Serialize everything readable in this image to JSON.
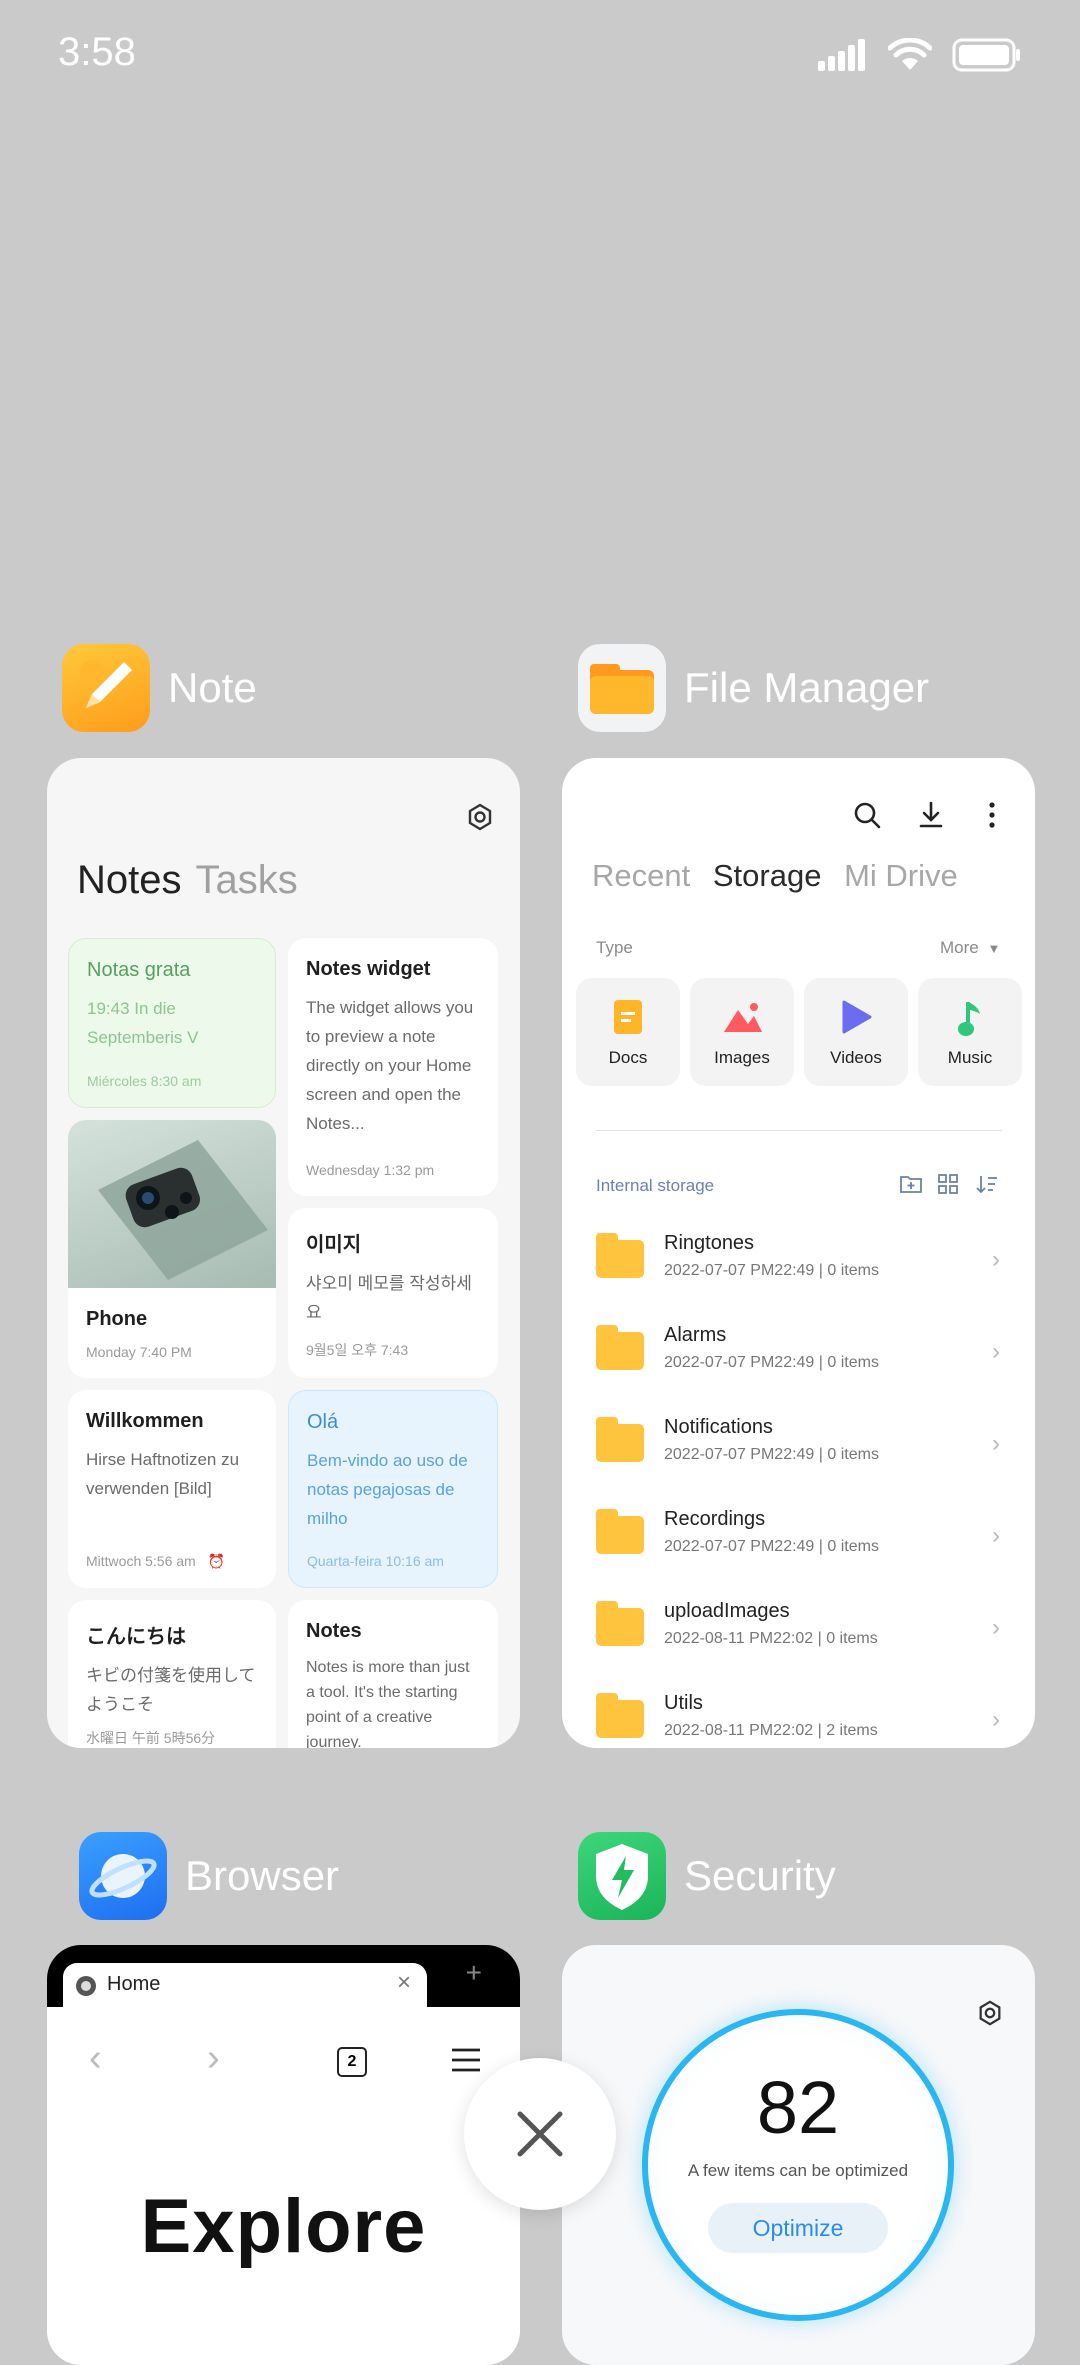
{
  "status": {
    "time": "3:58"
  },
  "apps": {
    "note": {
      "name": "Note",
      "tabs": [
        "Notes",
        "Tasks"
      ],
      "cards": [
        {
          "title": "Notas grata",
          "body": "19:43 In die Septemberis V",
          "date": "Miércoles 8:30 am"
        },
        {
          "title": "Notes widget",
          "body": "The widget allows you to preview a note directly on your Home screen and open the Notes...",
          "date": "Wednesday 1:32 pm"
        },
        {
          "title": "Phone",
          "date": "Monday 7:40 PM"
        },
        {
          "title": "이미지",
          "body": "샤오미 메모를 작성하세요",
          "date": "9월5일 오후 7:43"
        },
        {
          "title": "Willkommen",
          "body": "Hirse Haftnotizen zu verwenden [Bild]",
          "date": "Mittwoch 5:56 am"
        },
        {
          "title": "Olá",
          "body": "Bem-vindo ao uso de notas pegajosas de milho",
          "date": "Quarta-feira 10:16 am"
        },
        {
          "title": "こんにちは",
          "body": "キビの付箋を使用してようこそ",
          "date": "水曜日 午前 5時56分"
        },
        {
          "title": "Notes",
          "body": "Notes is more than just a tool. It's the starting point of a creative journey."
        }
      ]
    },
    "file_manager": {
      "name": "File Manager",
      "tabs": [
        "Recent",
        "Storage",
        "Mi Drive"
      ],
      "type_label": "Type",
      "more_label": "More",
      "types": [
        "Docs",
        "Images",
        "Videos",
        "Music"
      ],
      "storage_label": "Internal storage",
      "folders": [
        {
          "name": "Ringtones",
          "meta": "2022-07-07 PM22:49  |   0 items"
        },
        {
          "name": "Alarms",
          "meta": "2022-07-07 PM22:49  |   0 items"
        },
        {
          "name": "Notifications",
          "meta": "2022-07-07 PM22:49  |   0 items"
        },
        {
          "name": "Recordings",
          "meta": "2022-07-07 PM22:49  |   0 items"
        },
        {
          "name": "uploadImages",
          "meta": "2022-08-11 PM22:02  |   0 items"
        },
        {
          "name": "Utils",
          "meta": "2022-08-11 PM22:02  |   2 items"
        }
      ]
    },
    "browser": {
      "name": "Browser",
      "tab_title": "Home",
      "tab_count": "2",
      "hero": "Explore"
    },
    "security": {
      "name": "Security",
      "score": "82",
      "subtitle": "A few items can be optimized",
      "button": "Optimize"
    }
  },
  "colors": {
    "accent_blue": "#2a8de9",
    "background": "#cacaca"
  }
}
